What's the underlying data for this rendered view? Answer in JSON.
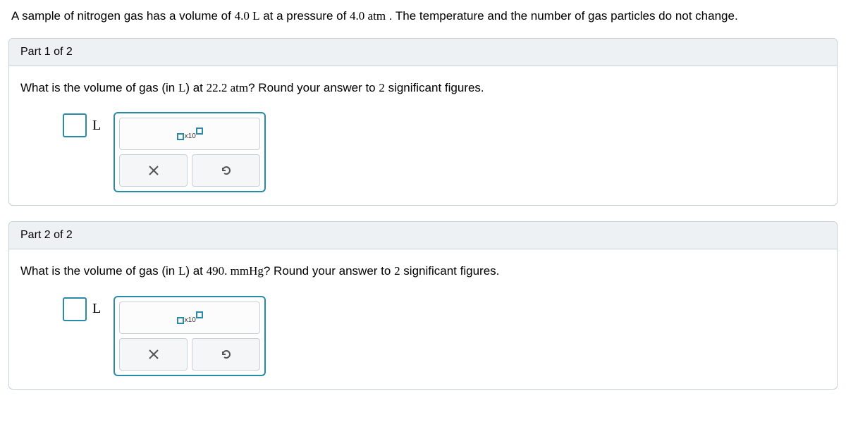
{
  "problem_statement": {
    "prefix": "A sample of nitrogen gas has a volume of ",
    "volume": "4.0 L",
    "mid": " at a pressure of ",
    "pressure": "4.0 atm",
    "suffix": ". The temperature and the number of gas particles do not change."
  },
  "parts": [
    {
      "header": "Part 1 of 2",
      "question": {
        "prefix": "What is the volume of gas (in ",
        "unit_symbol": "L",
        "mid": ") at ",
        "value": "22.2 atm",
        "suffix1": "? Round your answer to ",
        "sigfigs": "2",
        "suffix2": " significant figures."
      },
      "answer_unit": "L",
      "sci_label": "x10"
    },
    {
      "header": "Part 2 of 2",
      "question": {
        "prefix": "What is the volume of gas (in ",
        "unit_symbol": "L",
        "mid": ") at ",
        "value": "490. mmHg",
        "suffix1": "? Round your answer to ",
        "sigfigs": "2",
        "suffix2": " significant figures."
      },
      "answer_unit": "L",
      "sci_label": "x10"
    }
  ]
}
